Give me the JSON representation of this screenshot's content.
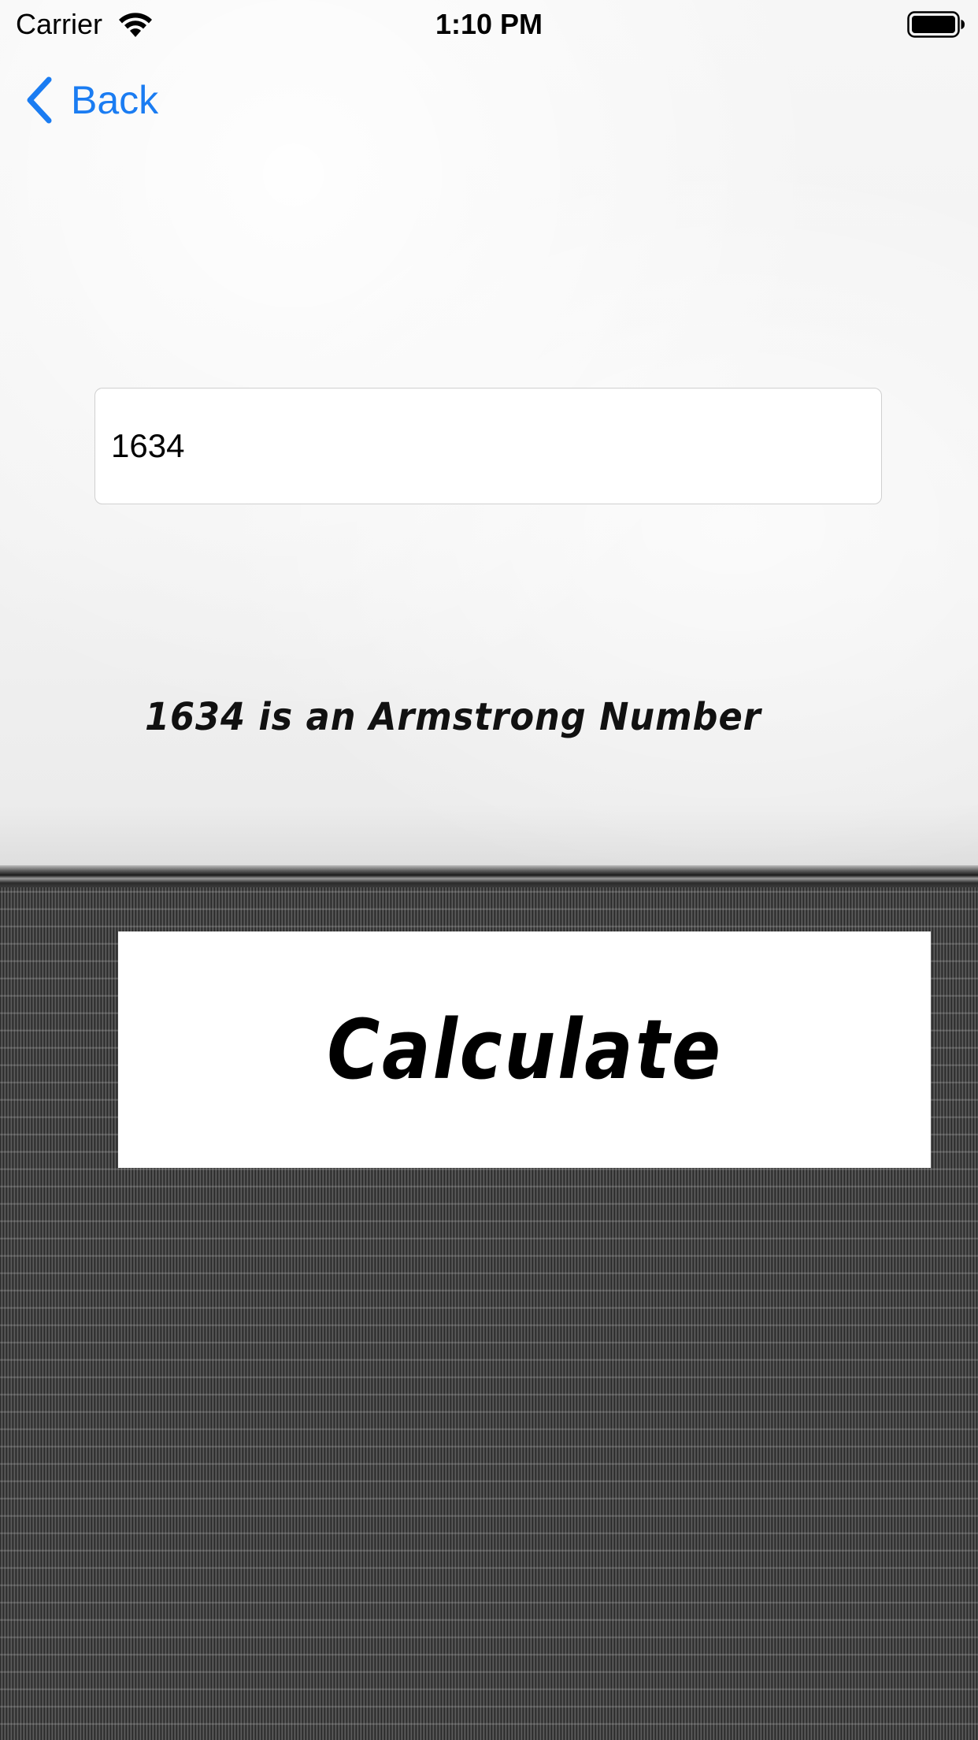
{
  "status_bar": {
    "carrier": "Carrier",
    "time": "1:10 PM",
    "wifi_icon": "wifi-icon",
    "battery_icon": "battery-icon"
  },
  "nav": {
    "back_label": "Back",
    "back_icon": "chevron-left-icon",
    "accent_color": "#1a7cf2"
  },
  "form": {
    "number_value": "1634",
    "number_placeholder": ""
  },
  "result": {
    "text": "1634 is an Armstrong Number"
  },
  "actions": {
    "calculate_label": "Calculate"
  }
}
